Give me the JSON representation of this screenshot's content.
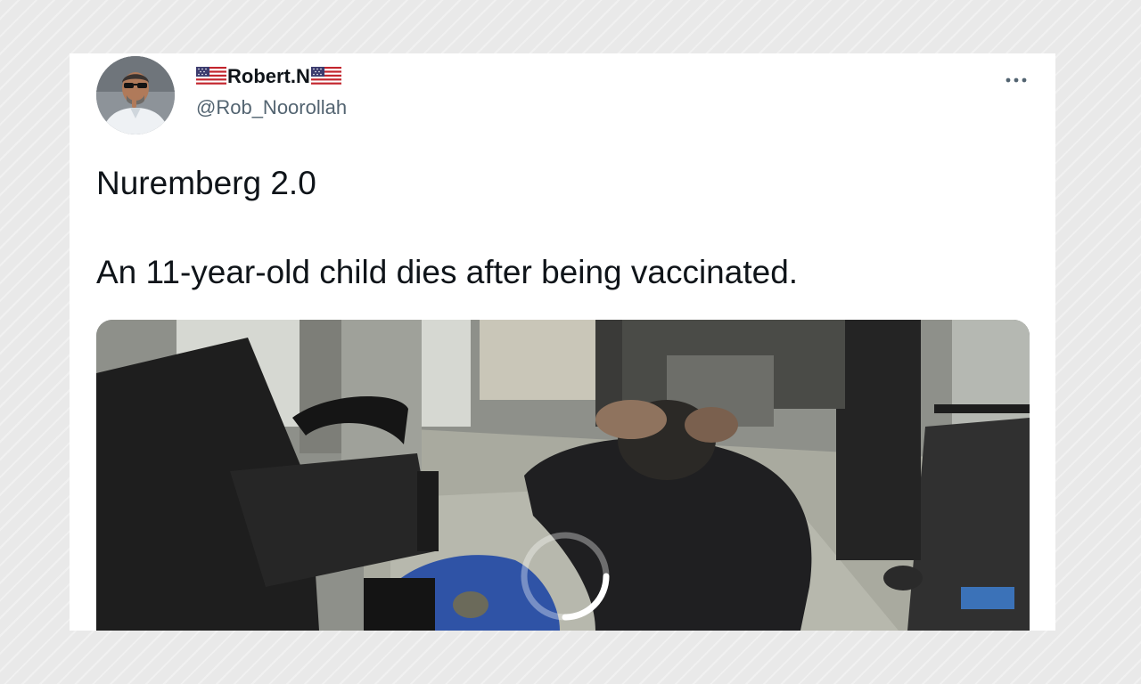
{
  "tweet": {
    "display_name": "Robert.N",
    "handle": "@Rob_Noorollah",
    "text_line1": "Nuremberg 2.0",
    "text_line2": "An 11-year-old child dies after being vaccinated.",
    "more_icon": "more-horizontal-icon",
    "flag_icon": "us-flag-icon",
    "media": {
      "type": "video",
      "state": "loading",
      "loading_icon": "loading-spinner-icon"
    }
  },
  "colors": {
    "primary_text": "#0f1419",
    "secondary_text": "#536471",
    "card_background": "#ffffff",
    "page_background": "#e9e9e9"
  }
}
